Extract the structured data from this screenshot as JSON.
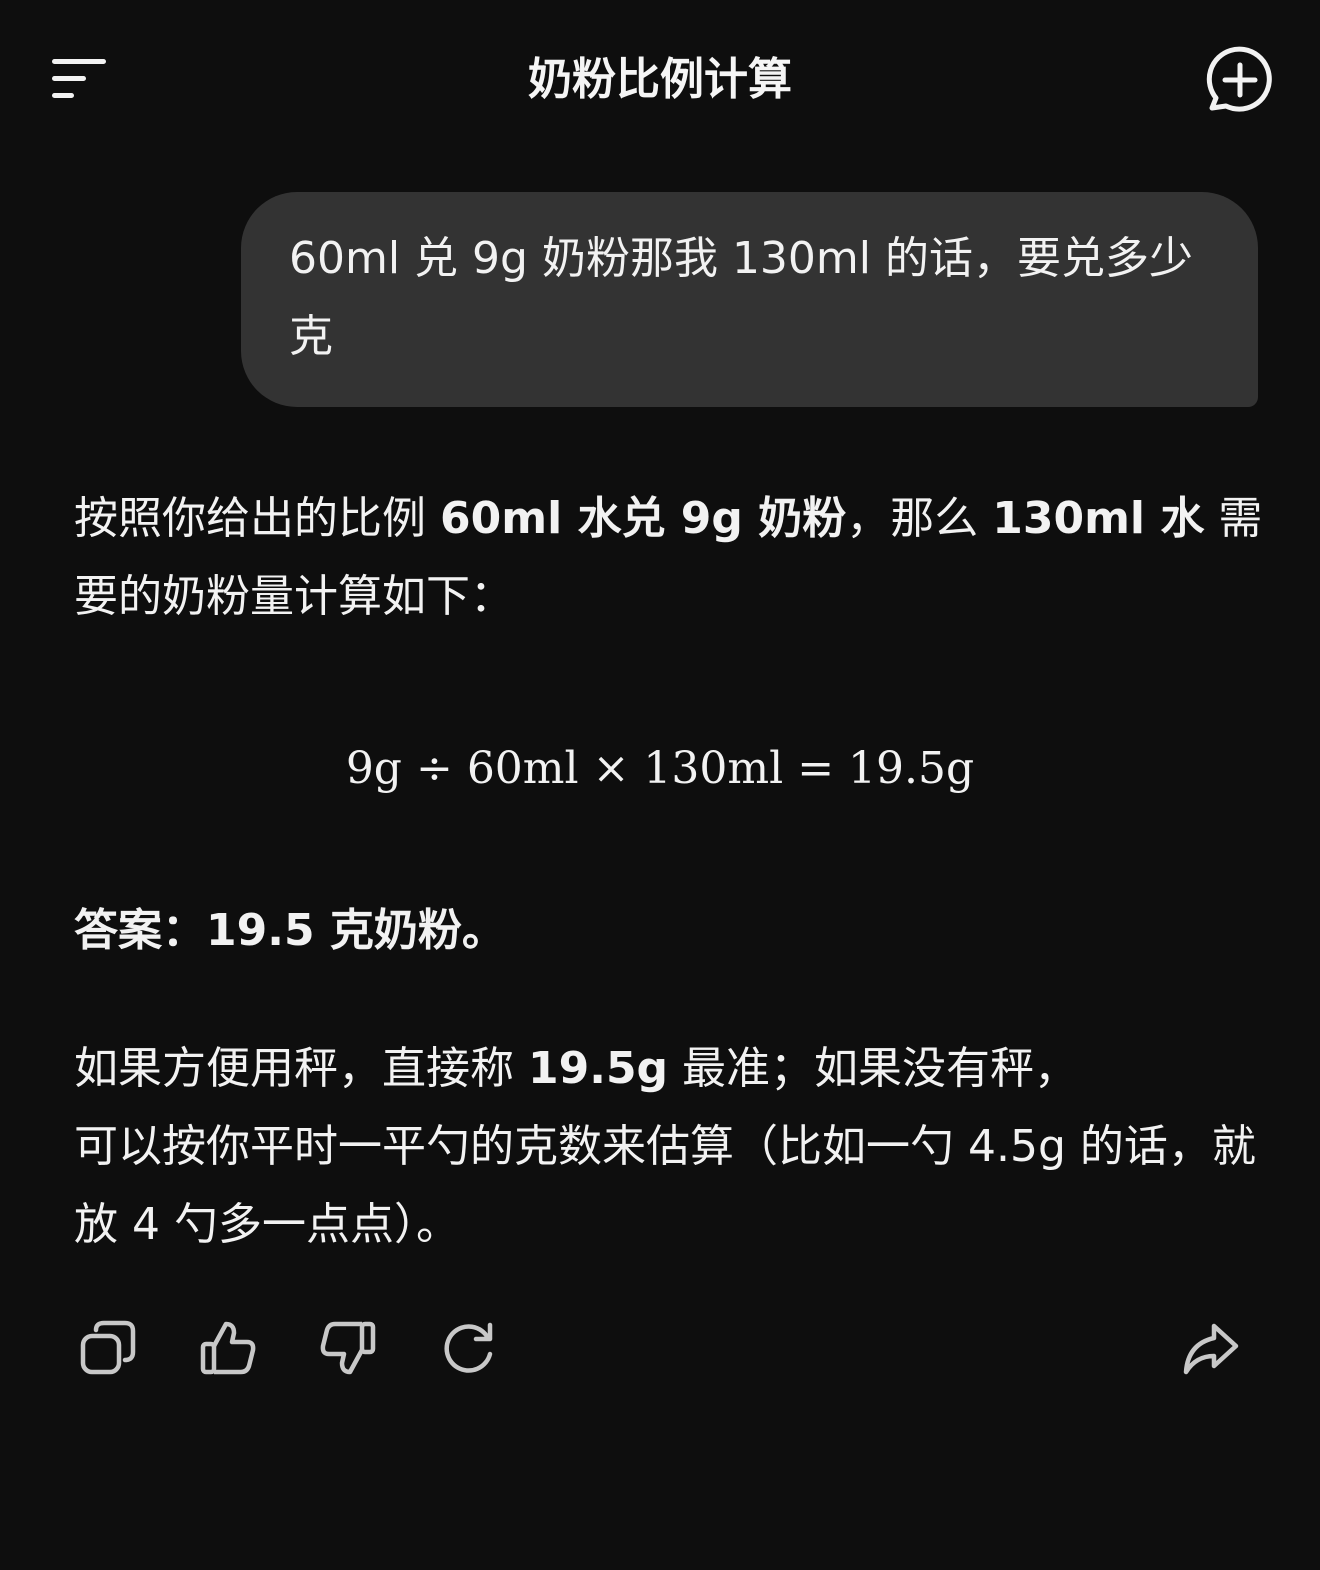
{
  "header": {
    "title": "奶粉比例计算",
    "menu_icon": "menu-icon",
    "new_chat_icon": "new-chat-icon"
  },
  "user_message": {
    "text": "60ml 兑 9g 奶粉那我 130ml 的话，要兑多少克"
  },
  "assistant": {
    "p1": {
      "t1": "按照你给出的比例 ",
      "b1": "60ml 水兑 9g 奶粉",
      "t2": "，那么 ",
      "b2": "130ml 水",
      "t3": " 需要的奶粉量计算如下："
    },
    "formula": "9g ÷ 60ml × 130ml = 19.5g",
    "p2": {
      "text": "答案：19.5 克奶粉。"
    },
    "p3": {
      "t1": "如果方便用秤，直接称 ",
      "b1": "19.5g",
      "t2": " 最准；如果没有秤，",
      "t3": "可以按你平时一平勺的克数来估算（比如一勺 4.5g 的话，就放 4 勺多一点点）。"
    }
  },
  "actions": [
    "copy-icon",
    "thumbs-up-icon",
    "thumbs-down-icon",
    "regenerate-icon",
    "share-icon"
  ],
  "colors": {
    "background": "#0e0e0e",
    "bubble": "#333333",
    "text": "#f2f2f2",
    "icon": "#c8c8c8"
  }
}
